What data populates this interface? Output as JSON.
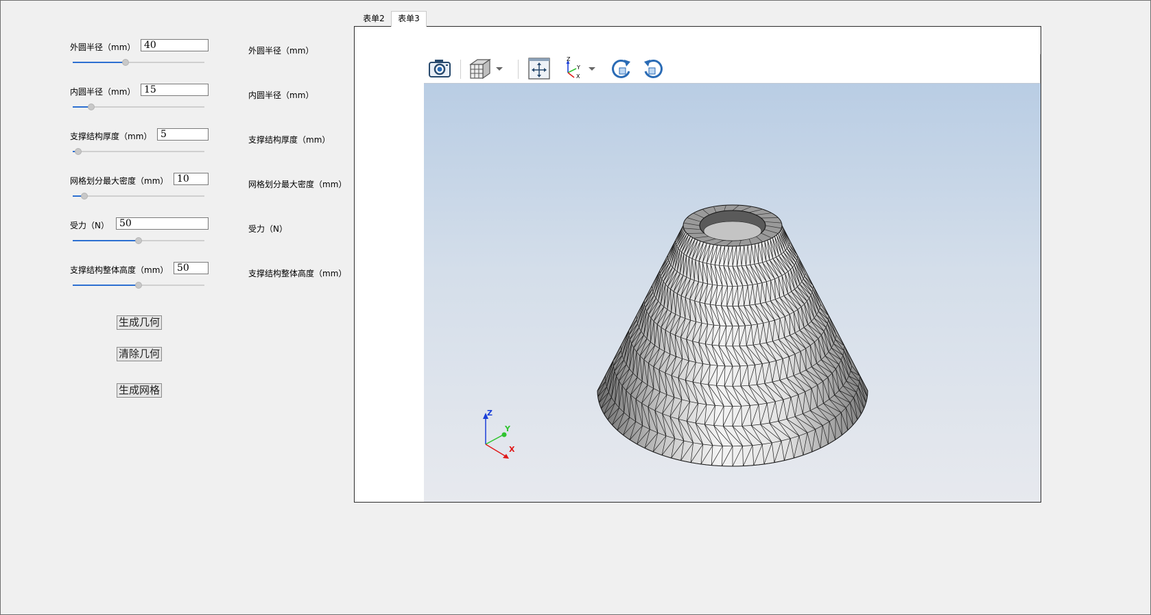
{
  "params": [
    {
      "label": "外圆半径（mm）",
      "value": "40",
      "fraction": 0.4
    },
    {
      "label": "内圆半径（mm）",
      "value": "15",
      "fraction": 0.14
    },
    {
      "label": "支撑结构厚度（mm）",
      "value": "5",
      "fraction": 0.04
    },
    {
      "label": "网格划分最大密度（mm）",
      "value": "10",
      "fraction": 0.09
    },
    {
      "label": "受力（N）",
      "value": "50",
      "fraction": 0.5
    },
    {
      "label": "支撑结构整体高度（mm）",
      "value": "50",
      "fraction": 0.5
    }
  ],
  "readouts": [
    "外圆半径（mm）",
    "内圆半径（mm）",
    "支撑结构厚度（mm）",
    "网格划分最大密度（mm）",
    "受力（N）",
    "支撑结构整体高度（mm）"
  ],
  "buttons": {
    "generate_geometry": "生成几何",
    "clear_geometry": "清除几何",
    "generate_mesh": "生成网格"
  },
  "tabs": [
    "表单2",
    "表单3"
  ],
  "active_tab": "表单3",
  "toolbar_icons": [
    "camera-icon",
    "view-cube-icon",
    "dropdown-arrow-icon",
    "fit-all-icon",
    "axes-view-icon",
    "dropdown-arrow-icon",
    "rotate-cw-icon",
    "rotate-ccw-icon"
  ],
  "axis_triad": {
    "z": "Z",
    "y": "Y",
    "x": "X"
  },
  "colors": {
    "slider_fill": "#2c6fd1",
    "axis_x": "#e01818",
    "axis_y": "#2fc42f",
    "axis_z": "#1a3fd8",
    "viewer_bg_top": "#b9cde4",
    "viewer_bg_bottom": "#e7e9ee"
  }
}
